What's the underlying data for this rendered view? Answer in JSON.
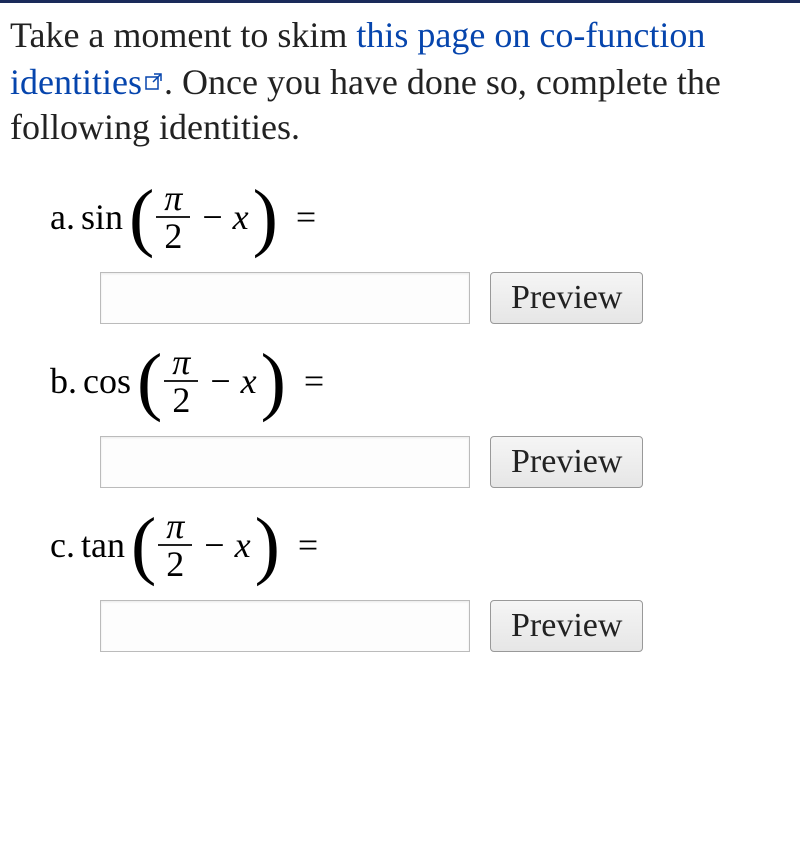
{
  "prompt": {
    "before_link": "Take a moment to skim ",
    "link_text": "this page on co-function identities",
    "after_link": ". Once you have done so, complete the following identities."
  },
  "problems": [
    {
      "label": "a.",
      "func": "sin",
      "pi": "π",
      "denom": "2",
      "var": "x",
      "eq": "=",
      "preview_label": "Preview",
      "input_value": ""
    },
    {
      "label": "b.",
      "func": "cos",
      "pi": "π",
      "denom": "2",
      "var": "x",
      "eq": "=",
      "preview_label": "Preview",
      "input_value": ""
    },
    {
      "label": "c.",
      "func": "tan",
      "pi": "π",
      "denom": "2",
      "var": "x",
      "eq": "=",
      "preview_label": "Preview",
      "input_value": ""
    }
  ]
}
